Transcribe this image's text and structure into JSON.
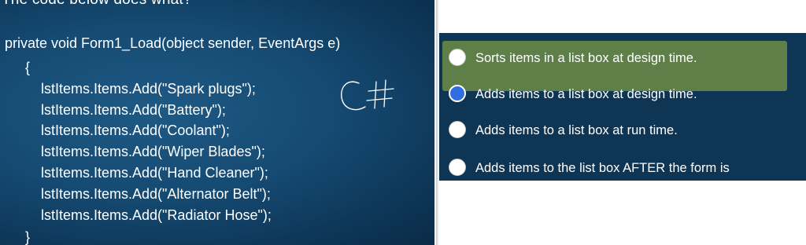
{
  "question": "The code below does what?",
  "code": {
    "lines": [
      "private void Form1_Load(object sender, EventArgs e)",
      "{",
      "lstItems.Items.Add(\"Spark plugs\");",
      "lstItems.Items.Add(\"Battery\");",
      "lstItems.Items.Add(\"Coolant\");",
      "lstItems.Items.Add(\"Wiper Blades\");",
      "lstItems.Items.Add(\"Hand Cleaner\");",
      "lstItems.Items.Add(\"Alternator Belt\");",
      "lstItems.Items.Add(\"Radiator Hose\");",
      "}"
    ],
    "handwritten_note": "C#"
  },
  "options": [
    {
      "label": "Sorts items in a list box at design time.",
      "selected": false,
      "highlighted": true
    },
    {
      "label": "Adds items to a list box at design time.",
      "selected": true,
      "highlighted": false
    },
    {
      "label": "Adds items to a list box at run time.",
      "selected": false,
      "highlighted": false
    },
    {
      "label": "Adds items to the list box AFTER the form is",
      "selected": false,
      "highlighted": false
    }
  ],
  "colors": {
    "code_background": "#154a72",
    "answer_background": "#0e3553",
    "highlight": "#5e7f48",
    "selected_radio": "#2f6ee0"
  }
}
